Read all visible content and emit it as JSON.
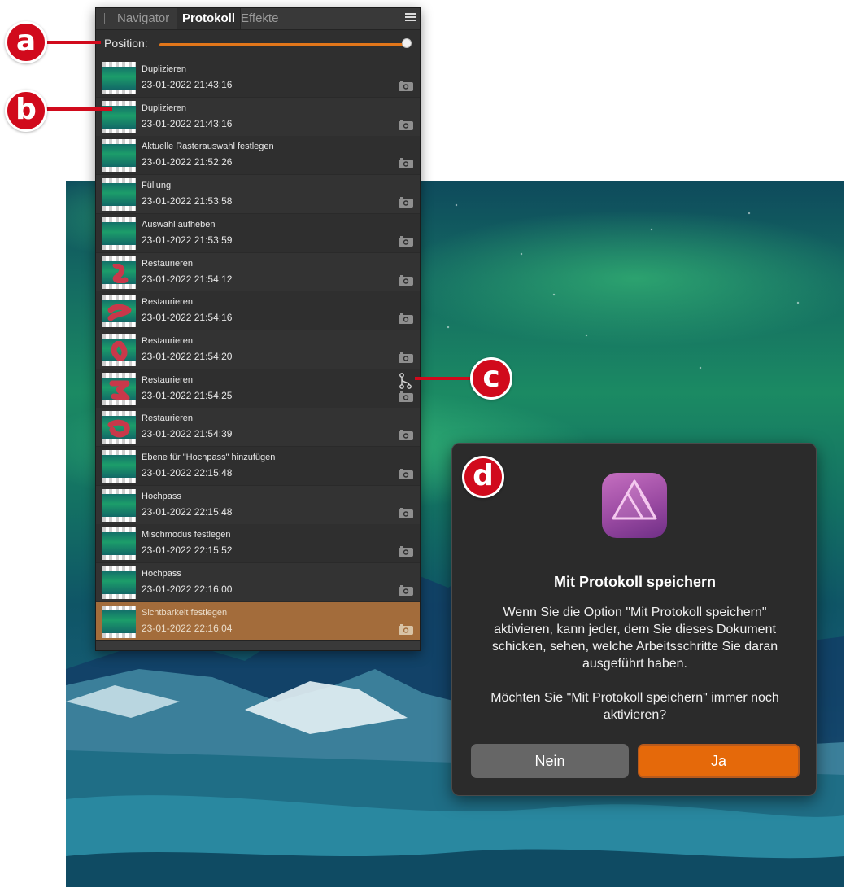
{
  "panel": {
    "tabs": [
      "Navigator",
      "Protokoll",
      "Effekte"
    ],
    "active_tab": "Protokoll",
    "position_label": "Position:",
    "position_value": 1.0,
    "entries": [
      {
        "title": "Duplizieren",
        "time": "23-01-2022 21:43:16",
        "thumb": "plain"
      },
      {
        "title": "Duplizieren",
        "time": "23-01-2022 21:43:16",
        "thumb": "plain"
      },
      {
        "title": "Aktuelle Rasterauswahl festlegen",
        "time": "23-01-2022 21:52:26",
        "thumb": "plain"
      },
      {
        "title": "Füllung",
        "time": "23-01-2022 21:53:58",
        "thumb": "plain"
      },
      {
        "title": "Auswahl aufheben",
        "time": "23-01-2022 21:53:59",
        "thumb": "plain"
      },
      {
        "title": "Restaurieren",
        "time": "23-01-2022 21:54:12",
        "thumb": "stroke"
      },
      {
        "title": "Restaurieren",
        "time": "23-01-2022 21:54:16",
        "thumb": "stroke"
      },
      {
        "title": "Restaurieren",
        "time": "23-01-2022 21:54:20",
        "thumb": "stroke"
      },
      {
        "title": "Restaurieren",
        "time": "23-01-2022 21:54:25",
        "thumb": "stroke",
        "branch": true
      },
      {
        "title": "Restaurieren",
        "time": "23-01-2022 21:54:39",
        "thumb": "stroke"
      },
      {
        "title": "Ebene für \"Hochpass\" hinzufügen",
        "time": "23-01-2022 22:15:48",
        "thumb": "plain"
      },
      {
        "title": "Hochpass",
        "time": "23-01-2022 22:15:48",
        "thumb": "plain"
      },
      {
        "title": "Mischmodus festlegen",
        "time": "23-01-2022 22:15:52",
        "thumb": "plain"
      },
      {
        "title": "Hochpass",
        "time": "23-01-2022 22:16:00",
        "thumb": "plain"
      },
      {
        "title": "Sichtbarkeit festlegen",
        "time": "23-01-2022 22:16:04",
        "thumb": "plain",
        "selected": true
      }
    ],
    "icons": {
      "menu": "menu-icon",
      "snapshot": "camera-icon",
      "branch": "branch-icon"
    }
  },
  "markers": {
    "a": "a",
    "b": "b",
    "c": "c",
    "d": "d"
  },
  "dialog": {
    "title": "Mit Protokoll speichern",
    "message_1": "Wenn Sie die Option \"Mit Protokoll speichern\" aktivieren, kann jeder, dem Sie dieses Dokument schicken, sehen, welche Arbeitsschritte Sie daran ausgeführt haben.",
    "message_2": "Möchten Sie \"Mit Protokoll speichern\" immer noch aktivieren?",
    "button_no": "Nein",
    "button_yes": "Ja",
    "icon": "affinity-photo-app-icon"
  },
  "colors": {
    "accent": "#e5690a",
    "selection": "#a36c3b",
    "marker": "#d10a1c",
    "panel_bg": "#2f2f2f"
  }
}
